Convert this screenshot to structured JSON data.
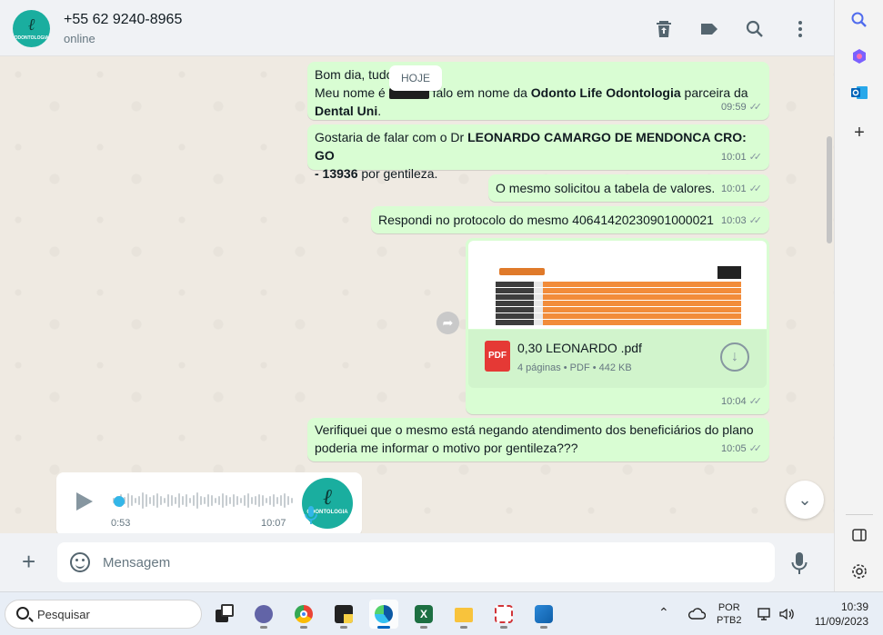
{
  "header": {
    "contact_phone": "+55 62 9240-8965",
    "status": "online",
    "avatar_text": "ODONTOLOGIA",
    "icons": [
      "archive-icon",
      "label-icon",
      "search-icon",
      "menu-icon"
    ]
  },
  "chat": {
    "date_chip": "HOJE",
    "messages": [
      {
        "line1": "Bom dia, tudo",
        "line2_pre": "Meu nome é ",
        "line2_mid": "falo em nome da ",
        "bold1": "Odonto Life Odontologia",
        "post1": " parceira da",
        "bold2": "Dental Uni",
        "post2": ".",
        "time": "09:59"
      },
      {
        "pre": "Gostaria de falar com o Dr ",
        "bold": "LEONARDO CAMARGO DE MENDONCA CRO: GO",
        "bold2": "- 13936",
        "post": " por gentileza.",
        "time": "10:01"
      },
      {
        "text": "O mesmo solicitou a tabela de valores.",
        "time": "10:01"
      },
      {
        "text": "Respondi no protocolo do mesmo 40641420230901000021",
        "time": "10:03"
      },
      {
        "text": "Verifiquei que o mesmo está negando atendimento dos beneficiários do plano",
        "text2": "poderia me informar o motivo por gentileza???",
        "time": "10:05"
      }
    ],
    "pdf": {
      "file_name": "0,30 LEONARDO .pdf",
      "info": "4 páginas • PDF • 442 KB",
      "badge": "PDF",
      "time": "10:04"
    },
    "voice": {
      "duration": "0:53",
      "time": "10:07"
    }
  },
  "composer": {
    "placeholder": "Mensagem"
  },
  "taskbar": {
    "search_label": "Pesquisar",
    "lang_line1": "POR",
    "lang_line2": "PTB2",
    "clock_time": "10:39",
    "clock_date": "11/09/2023"
  },
  "colors": {
    "outgoing_bubble": "#d9fdd3",
    "accent": "#1aae9f",
    "app_bg": "#efeae2"
  }
}
